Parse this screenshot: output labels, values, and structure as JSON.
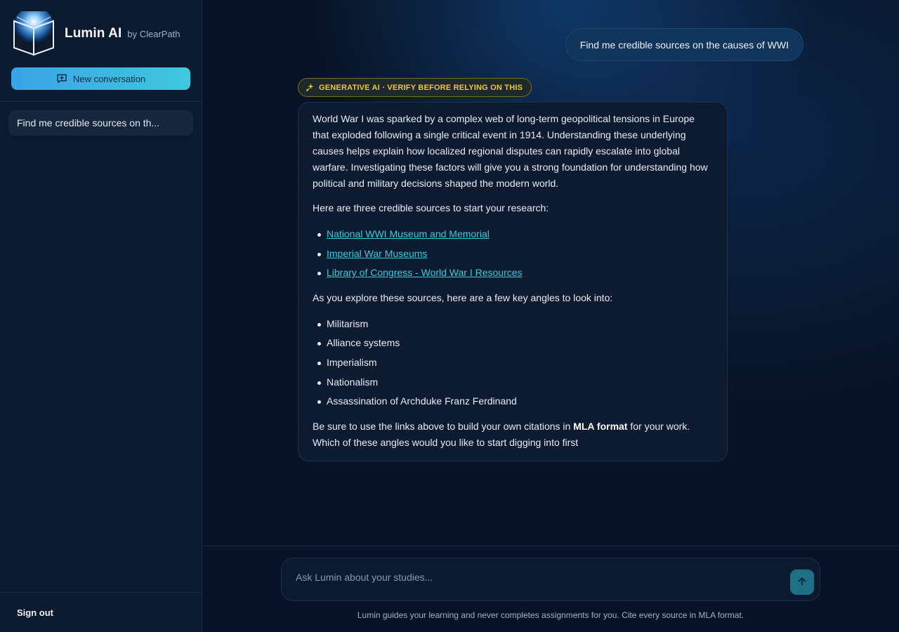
{
  "brand": {
    "name": "Lumin AI",
    "by": "by ClearPath"
  },
  "sidebar": {
    "new_conversation_label": "New conversation",
    "history": [
      {
        "label": "Find me credible sources on th..."
      }
    ],
    "sign_out_label": "Sign out"
  },
  "chat": {
    "user_message": "Find me credible sources on the causes of WWI",
    "ai_badge": "GENERATIVE AI · VERIFY BEFORE RELYING ON THIS",
    "ai_intro": "World War I was sparked by a complex web of long-term geopolitical tensions in Europe that exploded following a single critical event in 1914. Understanding these underlying causes helps explain how localized regional disputes can rapidly escalate into global warfare. Investigating these factors will give you a strong foundation for understanding how political and military decisions shaped the modern world.",
    "sources_intro": "Here are three credible sources to start your research:",
    "sources": [
      {
        "label": "National WWI Museum and Memorial"
      },
      {
        "label": "Imperial War Museums"
      },
      {
        "label": "Library of Congress - World War I Resources"
      }
    ],
    "angles_intro": "As you explore these sources, here are a few key angles to look into:",
    "angles": [
      "Militarism",
      "Alliance systems",
      "Imperialism",
      "Nationalism",
      "Assassination of Archduke Franz Ferdinand"
    ],
    "closing_before": "Be sure to use the links above to build your own citations in ",
    "closing_bold": "MLA format",
    "closing_after": " for your work. Which of these angles would you like to start digging into first"
  },
  "composer": {
    "placeholder": "Ask Lumin about your studies...",
    "disclaimer": "Lumin guides your learning and never completes assignments for you. Cite every source in MLA format."
  },
  "colors": {
    "accent_start": "#3aa3e6",
    "accent_end": "#3ec9dd",
    "link": "#3ec9dd",
    "badge": "#f0c63a",
    "background": "#081426"
  },
  "icons": {
    "logo": "glowing-book-icon",
    "new_conversation": "chat-plus-icon",
    "badge": "sparkle-icon",
    "send": "arrow-up-icon"
  }
}
